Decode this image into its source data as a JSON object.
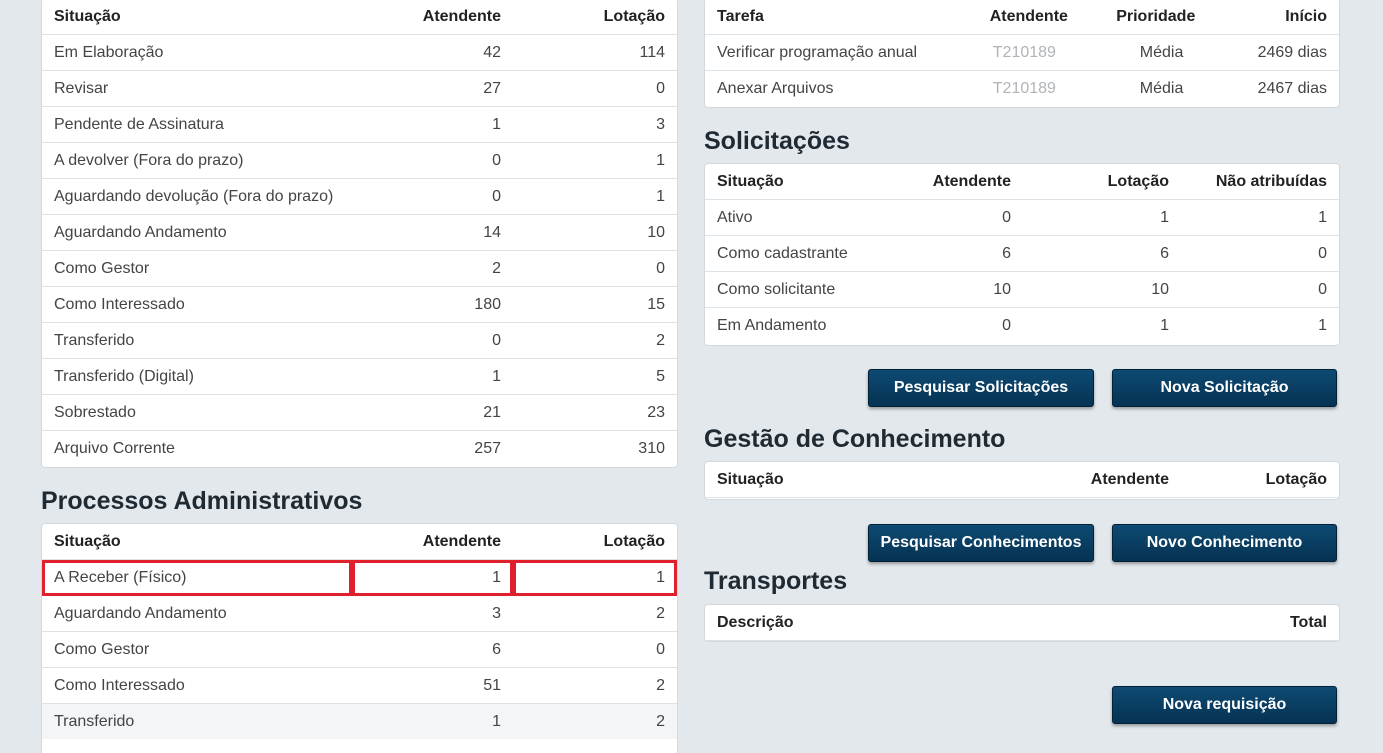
{
  "docs_table": {
    "headers": [
      "Situação",
      "Atendente",
      "Lotação"
    ],
    "rows": [
      [
        "Em Elaboração",
        "42",
        "114"
      ],
      [
        "Revisar",
        "27",
        "0"
      ],
      [
        "Pendente de Assinatura",
        "1",
        "3"
      ],
      [
        "A devolver (Fora do prazo)",
        "0",
        "1"
      ],
      [
        "Aguardando devolução (Fora do prazo)",
        "0",
        "1"
      ],
      [
        "Aguardando Andamento",
        "14",
        "10"
      ],
      [
        "Como Gestor",
        "2",
        "0"
      ],
      [
        "Como Interessado",
        "180",
        "15"
      ],
      [
        "Transferido",
        "0",
        "2"
      ],
      [
        "Transferido (Digital)",
        "1",
        "5"
      ],
      [
        "Sobrestado",
        "21",
        "23"
      ],
      [
        "Arquivo Corrente",
        "257",
        "310"
      ]
    ]
  },
  "processos": {
    "title": "Processos Administrativos",
    "headers": [
      "Situação",
      "Atendente",
      "Lotação"
    ],
    "rows": [
      [
        "A Receber (Físico)",
        "1",
        "1"
      ],
      [
        "Aguardando Andamento",
        "3",
        "2"
      ],
      [
        "Como Gestor",
        "6",
        "0"
      ],
      [
        "Como Interessado",
        "51",
        "2"
      ],
      [
        "Transferido",
        "1",
        "2"
      ]
    ]
  },
  "tarefas": {
    "headers": [
      "Tarefa",
      "Atendente",
      "Prioridade",
      "Início"
    ],
    "rows": [
      [
        "Verificar programação anual",
        "T210189",
        "Média",
        "2469 dias"
      ],
      [
        "Anexar Arquivos",
        "T210189",
        "Média",
        "2467 dias"
      ]
    ]
  },
  "solicitacoes": {
    "title": "Solicitações",
    "headers": [
      "Situação",
      "Atendente",
      "Lotação",
      "Não atribuídas"
    ],
    "rows": [
      [
        "Ativo",
        "0",
        "1",
        "1"
      ],
      [
        "Como cadastrante",
        "6",
        "6",
        "0"
      ],
      [
        "Como solicitante",
        "10",
        "10",
        "0"
      ],
      [
        "Em Andamento",
        "0",
        "1",
        "1"
      ]
    ],
    "search_button": "Pesquisar Solicitações",
    "new_button": "Nova Solicitação"
  },
  "conhecimento": {
    "title": "Gestão de Conhecimento",
    "headers": [
      "Situação",
      "Atendente",
      "Lotação"
    ],
    "search_button": "Pesquisar Conhecimentos",
    "new_button": "Novo Conhecimento"
  },
  "transportes": {
    "title": "Transportes",
    "headers": [
      "Descrição",
      "Total"
    ],
    "new_button": "Nova requisição"
  },
  "colors": {
    "highlight": "#e0202c",
    "button": "#053252"
  }
}
